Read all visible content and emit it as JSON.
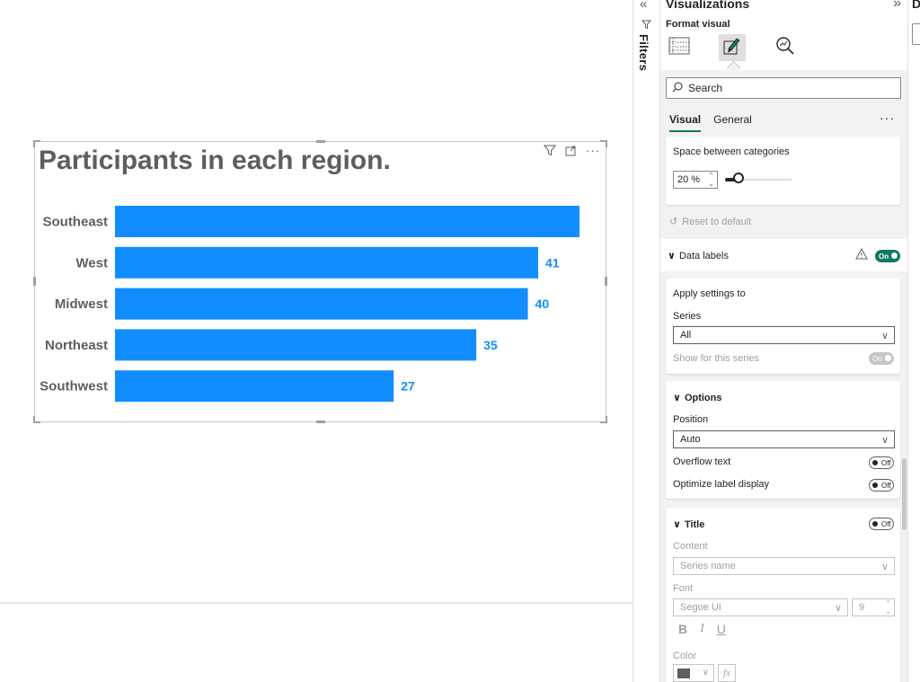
{
  "chart_data": {
    "type": "bar",
    "orientation": "horizontal",
    "title": "Participants in each region.",
    "categories": [
      "Southeast",
      "West",
      "Midwest",
      "Northeast",
      "Southwest"
    ],
    "values": [
      45,
      41,
      40,
      35,
      27
    ],
    "data_labels": [
      "",
      "41",
      "40",
      "35",
      "27"
    ],
    "bar_color": "#118dff",
    "label_color": "#118dff",
    "xlim": [
      0,
      45
    ],
    "grid": false
  },
  "filters": {
    "label": "Filters"
  },
  "viz_pane": {
    "title": "Visualizations",
    "format_label": "Format visual",
    "search_placeholder": "Search",
    "tabs": [
      "Visual",
      "General"
    ],
    "more": "···",
    "space_label": "Space between categories",
    "space_value": "20 %",
    "space_slider_fraction": 0.2,
    "reset": "Reset to default",
    "data_labels": {
      "title": "Data labels",
      "toggle": "On"
    },
    "apply": {
      "title": "Apply settings to",
      "series_label": "Series",
      "series_value": "All",
      "show_label": "Show for this series",
      "show_toggle": "On"
    },
    "options": {
      "title": "Options",
      "position_label": "Position",
      "position_value": "Auto",
      "overflow_label": "Overflow text",
      "overflow_toggle": "Off",
      "optimize_label": "Optimize label display",
      "optimize_toggle": "Off"
    },
    "title_section": {
      "title": "Title",
      "toggle": "Off",
      "content_label": "Content",
      "content_value": "Series name",
      "font_label": "Font",
      "font_value": "Segoe UI",
      "font_size": "9",
      "bold": "B",
      "italic": "I",
      "underline": "U",
      "color_label": "Color",
      "fx": "fx"
    }
  },
  "data_pane": {
    "initial": "D"
  },
  "colors": {
    "accent": "#117865",
    "bar": "#118dff"
  }
}
